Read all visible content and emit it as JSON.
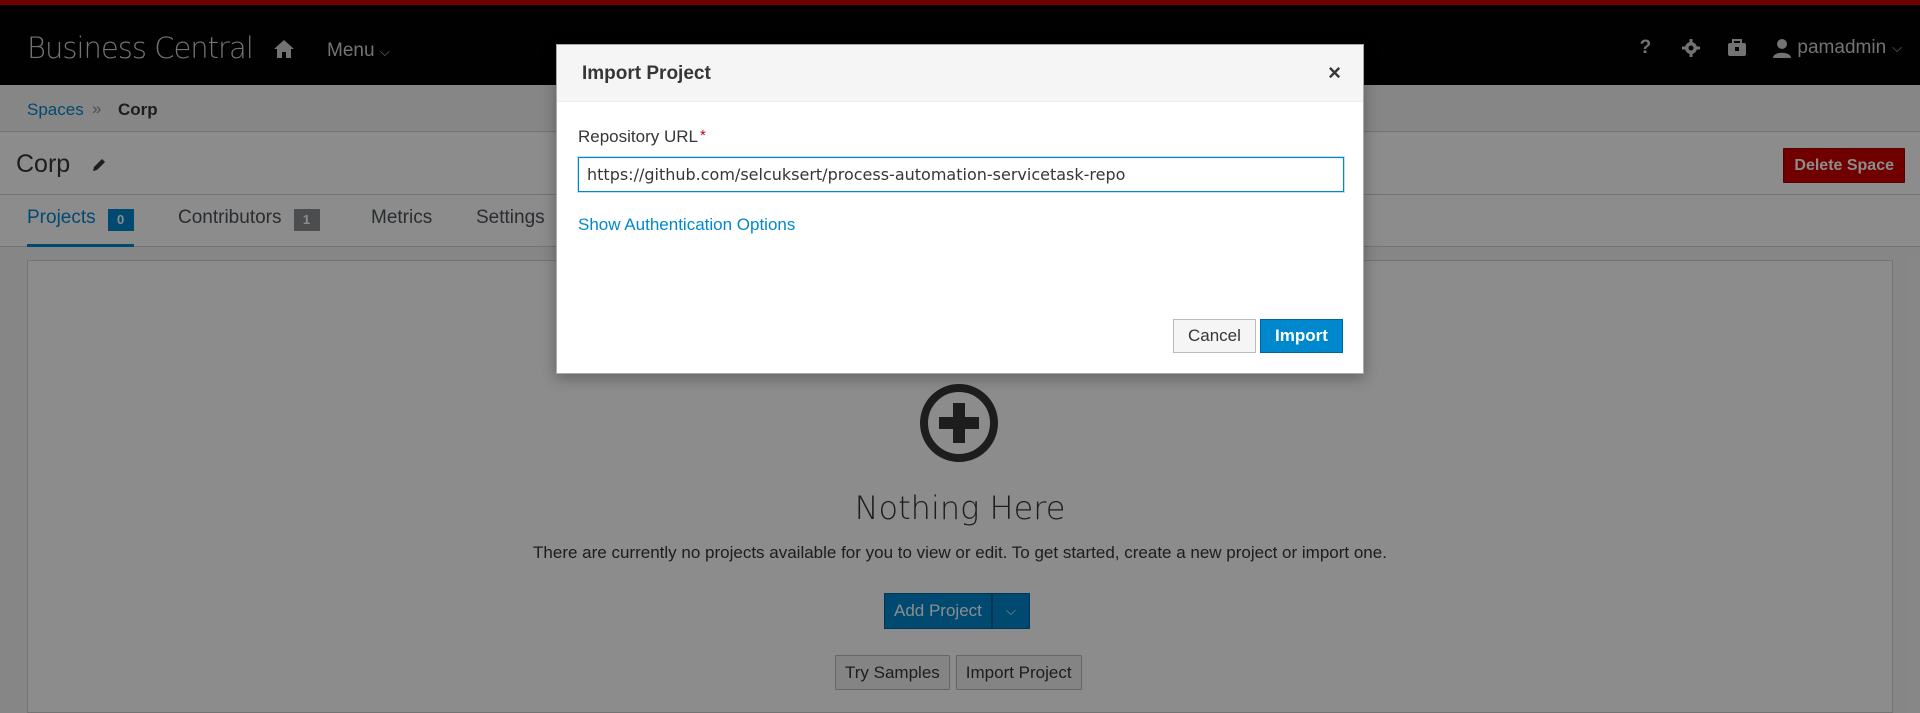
{
  "header": {
    "brand": "Business Central",
    "menu_label": "Menu",
    "user_name": "pamadmin",
    "icons": [
      "home-icon",
      "help-icon",
      "gear-icon",
      "briefcase-icon",
      "user-icon"
    ]
  },
  "breadcrumb": {
    "spaces_label": "Spaces",
    "separator": "»",
    "current": "Corp"
  },
  "space": {
    "title": "Corp",
    "delete_label": "Delete Space"
  },
  "tabs": [
    {
      "label": "Projects",
      "count": "0",
      "active": true
    },
    {
      "label": "Contributors",
      "count": "1",
      "active": false
    },
    {
      "label": "Metrics",
      "active": false
    },
    {
      "label": "Settings",
      "active": false
    }
  ],
  "empty_state": {
    "title": "Nothing Here",
    "text": "There are currently no projects available for you to view or edit. To get started, create a new project or import one.",
    "add_project_label": "Add Project",
    "try_samples_label": "Try Samples",
    "import_project_label": "Import Project"
  },
  "modal": {
    "title": "Import Project",
    "close_glyph": "×",
    "field_label": "Repository URL",
    "required_mark": "*",
    "url_value": "https://github.com/selcuksert/process-automation-servicetask-repo",
    "auth_link": "Show Authentication Options",
    "cancel_label": "Cancel",
    "import_label": "Import"
  },
  "colors": {
    "accent": "#0088ce",
    "danger": "#cc0000",
    "topbar": "#030303"
  }
}
